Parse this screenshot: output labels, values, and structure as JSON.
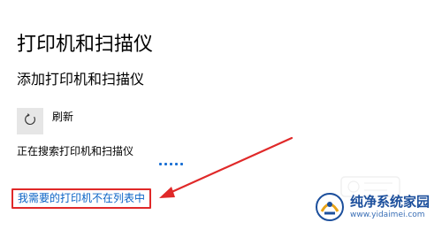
{
  "page": {
    "title": "打印机和扫描仪",
    "section_title": "添加打印机和扫描仪"
  },
  "refresh": {
    "label": "刷新",
    "icon": "refresh-icon"
  },
  "search": {
    "status_text": "正在搜索打印机和扫描仪"
  },
  "link": {
    "not_listed_label": "我需要的打印机不在列表中"
  },
  "annotation": {
    "highlight_color": "#e02929"
  },
  "watermark": {
    "title": "纯净系统家园",
    "url": "www.yidaimei.com"
  },
  "colors": {
    "accent": "#0b63c6",
    "progress": "#1a6fd4"
  }
}
